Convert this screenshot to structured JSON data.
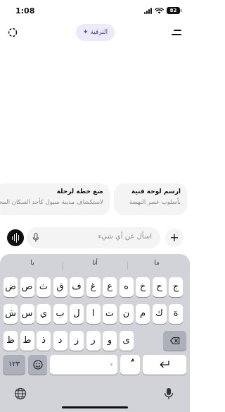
{
  "status_bar": {
    "time": "1:08",
    "battery": "82"
  },
  "top_bar": {
    "upgrade_label": "الترقية",
    "upgrade_icon": "sparkle-icon"
  },
  "suggestions": [
    {
      "title": "ارسم لوحة فنية",
      "subtitle": "بأسلوب عصر النهضة"
    },
    {
      "title": "ضع خطة لرحلة",
      "subtitle": "لاستكشاف مدينة سيول كأحد السكان المحليين"
    }
  ],
  "composer": {
    "placeholder": "اسأل عن أي شيء"
  },
  "keyboard": {
    "predictions": [
      "يا",
      "أنا",
      "ما"
    ],
    "row1": [
      "ض",
      "ص",
      "ث",
      "ق",
      "ف",
      "غ",
      "ع",
      "ه",
      "خ",
      "ح",
      "ج"
    ],
    "row2": [
      "ش",
      "س",
      "ي",
      "ب",
      "ل",
      "ا",
      "ت",
      "ن",
      "م",
      "ك",
      "ة"
    ],
    "row3": [
      "ظ",
      "ط",
      "ذ",
      "د",
      "ز",
      "ر",
      "و",
      "ى"
    ],
    "numbers_key": "١٢٣",
    "emoji_key": "emoji-icon",
    "space_hint": "ء",
    "diacritic_key": "ًٌ",
    "return_key": "return-icon"
  }
}
